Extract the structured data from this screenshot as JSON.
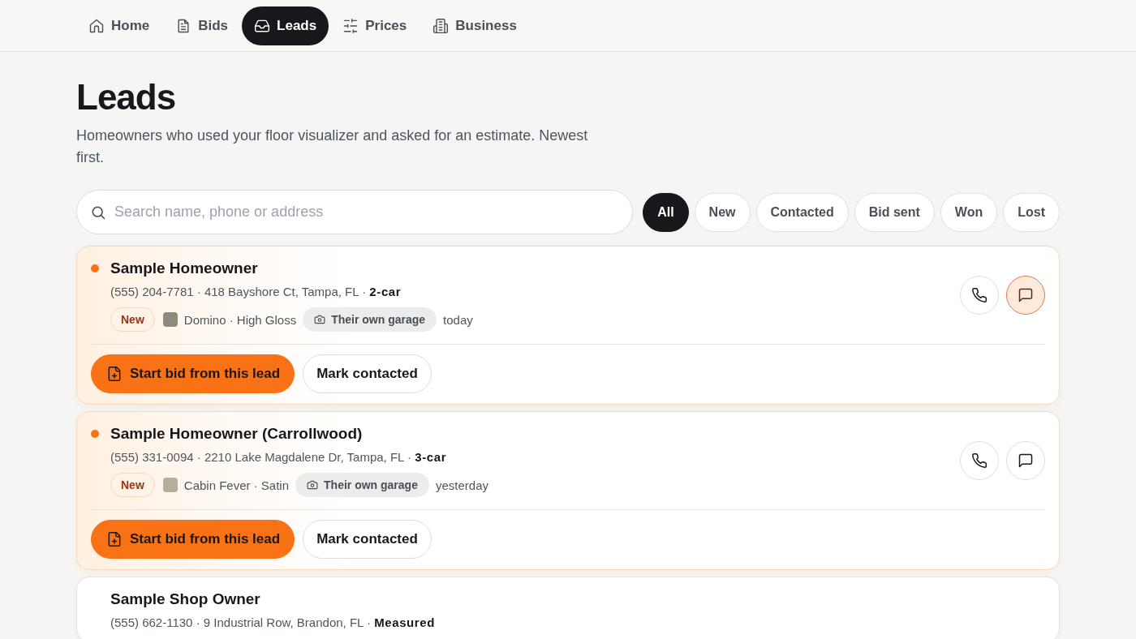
{
  "nav": {
    "items": [
      {
        "label": "Home",
        "selected": false
      },
      {
        "label": "Bids",
        "selected": false
      },
      {
        "label": "Leads",
        "selected": true
      },
      {
        "label": "Prices",
        "selected": false
      },
      {
        "label": "Business",
        "selected": false
      }
    ]
  },
  "header": {
    "title": "Leads",
    "subtitle": "Homeowners who used your floor visualizer and asked for an estimate. Newest first."
  },
  "search": {
    "placeholder": "Search name, phone or address"
  },
  "filters": [
    {
      "label": "All",
      "selected": true
    },
    {
      "label": "New",
      "selected": false
    },
    {
      "label": "Contacted",
      "selected": false
    },
    {
      "label": "Bid sent",
      "selected": false
    },
    {
      "label": "Won",
      "selected": false
    },
    {
      "label": "Lost",
      "selected": false
    }
  ],
  "leads": [
    {
      "name": "Sample Homeowner",
      "highlighted": true,
      "details": "(555) 204-7781 · 418 Bayshore Ct, Tampa, FL · **2-car**",
      "status": "New",
      "finish": {
        "color": "#8f8b7b",
        "label": "Domino · High Gloss"
      },
      "photo_source": "Their own garage",
      "time": "today",
      "message_highlighted": true,
      "actions": [
        {
          "label": "Start bid from this lead",
          "kind": "primary"
        },
        {
          "label": "Mark contacted",
          "kind": "secondary"
        }
      ]
    },
    {
      "name": "Sample Homeowner (Carrollwood)",
      "highlighted": true,
      "details": "(555) 331-0094 · 2210 Lake Magdalene Dr, Tampa, FL · **3-car**",
      "status": "New",
      "finish": {
        "color": "#b5b09b",
        "label": "Cabin Fever · Satin"
      },
      "photo_source": "Their own garage",
      "time": "yesterday",
      "message_highlighted": false,
      "actions": [
        {
          "label": "Start bid from this lead",
          "kind": "primary"
        },
        {
          "label": "Mark contacted",
          "kind": "secondary"
        }
      ]
    },
    {
      "name": "Sample Shop Owner",
      "highlighted": false,
      "details": "(555) 662-1130 · 9 Industrial Row, Brandon, FL · **Measured**"
    }
  ]
}
